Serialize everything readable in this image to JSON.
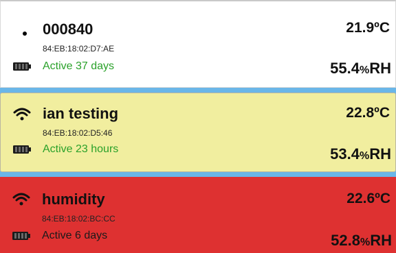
{
  "sensors": [
    {
      "name": "000840",
      "mac": "84:EB:18:02:D7:AE",
      "status": "Active 37 days",
      "status_color": "#2aa12a",
      "temperature": "21.9ºC",
      "humidity_value": "55.4",
      "humidity_percent": "%",
      "humidity_unit": "RH",
      "card_color": "#ffffff",
      "signal_icon": "dot-icon",
      "battery_icon": "battery-full-icon"
    },
    {
      "name": "ian testing",
      "mac": "84:EB:18:02:D5:46",
      "status": "Active 23 hours",
      "status_color": "#2aa12a",
      "temperature": "22.8ºC",
      "humidity_value": "53.4",
      "humidity_percent": "%",
      "humidity_unit": "RH",
      "card_color": "#f1ee9f",
      "signal_icon": "wifi-icon",
      "battery_icon": "battery-full-icon"
    },
    {
      "name": "humidity",
      "mac": "84:EB:18:02:BC:CC",
      "status": "Active 6 days",
      "status_color": "#1a1a1a",
      "temperature": "22.6ºC",
      "humidity_value": "52.8",
      "humidity_percent": "%",
      "humidity_unit": "RH",
      "card_color": "#de3131",
      "signal_icon": "wifi-icon",
      "battery_icon": "battery-full-icon"
    }
  ]
}
